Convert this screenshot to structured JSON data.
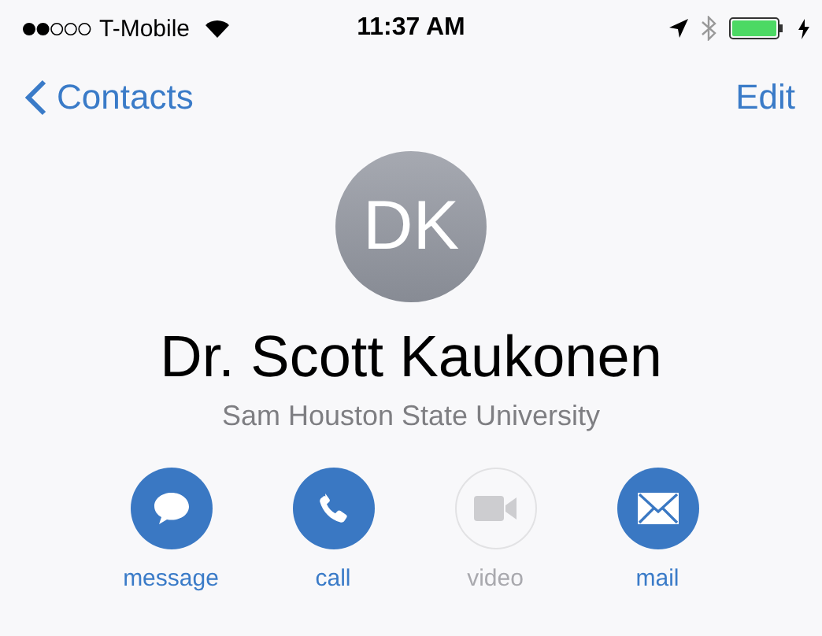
{
  "status_bar": {
    "carrier": "T-Mobile",
    "time": "11:37 AM"
  },
  "nav": {
    "back": "Contacts",
    "edit": "Edit"
  },
  "contact": {
    "initials": "DK",
    "name": "Dr. Scott Kaukonen",
    "organization": "Sam Houston State University"
  },
  "actions": [
    {
      "kind": "message",
      "label": "message",
      "disabled": false
    },
    {
      "kind": "call",
      "label": "call",
      "disabled": false
    },
    {
      "kind": "video",
      "label": "video",
      "disabled": true
    },
    {
      "kind": "mail",
      "label": "mail",
      "disabled": false
    }
  ]
}
